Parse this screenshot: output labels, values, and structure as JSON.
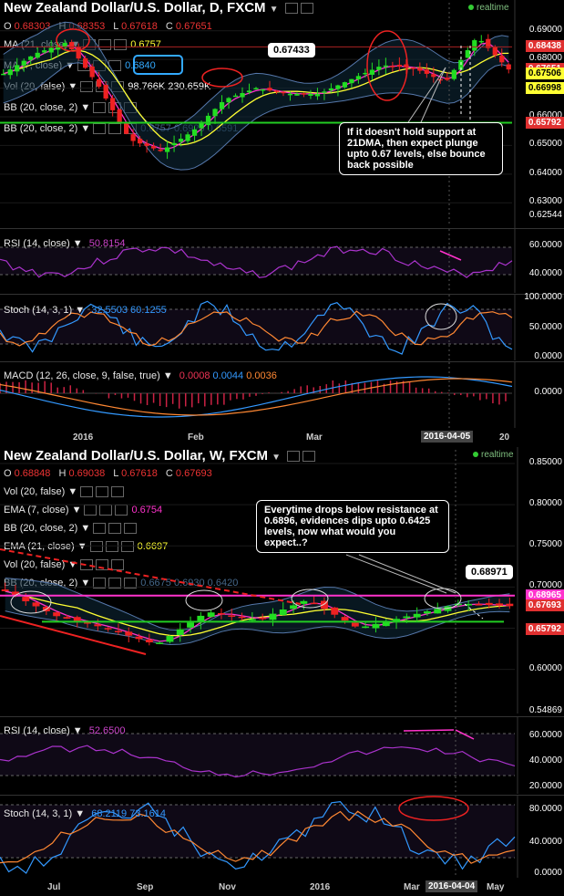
{
  "top": {
    "title": "New Zealand Dollar/U.S. Dollar, D, FXCM",
    "realtime_label": "realtime",
    "ohlc": {
      "o_label": "O",
      "o": "0.68303",
      "h_label": "H",
      "h": "0.68353",
      "l_label": "L",
      "l": "0.67618",
      "c_label": "C",
      "c": "0.67651"
    },
    "indicators": [
      {
        "label": "MA (21, close)",
        "value": "0.6757",
        "color": "#ffff33"
      },
      {
        "label": "MA (7, close)",
        "value": "0.6840",
        "color": "#33aaff"
      },
      {
        "label": "Vol (20, false)",
        "value": "98.766K 230.659K",
        "color": "#ffffff"
      },
      {
        "label": "BB (20, close, 2)",
        "value": "",
        "color": "#ffffff"
      },
      {
        "label": "BB (20, close, 2)",
        "value": "0.6757 0.6923 0.6591",
        "color": "#446688"
      }
    ],
    "price_axis": [
      "0.69000",
      "0.68000",
      "0.67000",
      "0.66000",
      "0.65000",
      "0.64000",
      "0.63000",
      "0.62544"
    ],
    "price_tags": [
      {
        "value": "0.68438",
        "bg": "#e03030",
        "fg": "#ffffff"
      },
      {
        "value": "0.67651",
        "bg": "#e03030",
        "fg": "#ffffff"
      },
      {
        "value": "0.67506",
        "bg": "#ffff33",
        "fg": "#000000"
      },
      {
        "value": "0.66998",
        "bg": "#ffff33",
        "fg": "#000000"
      },
      {
        "value": "0.65792",
        "bg": "#e03030",
        "fg": "#ffffff"
      }
    ],
    "price_label_box": "0.67433",
    "callout": "If it doesn't hold support at 21DMA, then expect plunge upto 0.67 levels, else bounce back possible",
    "rsi": {
      "label": "RSI (14, close)",
      "value": "50.8154",
      "axis": [
        "60.0000",
        "40.0000"
      ]
    },
    "stoch": {
      "label": "Stoch (14, 3, 1)",
      "value": "32.5503 60.1255",
      "axis": [
        "100.0000",
        "50.0000",
        "0.0000"
      ]
    },
    "macd": {
      "label": "MACD (12, 26, close, 9, false, true)",
      "value1": "0.0008",
      "value2": "0.0044",
      "value3": "0.0036",
      "axis": [
        "0.0000"
      ]
    },
    "x_axis": {
      "labels": [
        "2016",
        "Feb",
        "Mar",
        "20"
      ],
      "selected": "2016-04-05"
    }
  },
  "bottom": {
    "title": "New Zealand Dollar/U.S. Dollar, W, FXCM",
    "realtime_label": "realtime",
    "ohlc": {
      "o_label": "O",
      "o": "0.68848",
      "h_label": "H",
      "h": "0.69038",
      "l_label": "L",
      "l": "0.67618",
      "c_label": "C",
      "c": "0.67693"
    },
    "indicators": [
      {
        "label": "Vol (20, false)",
        "value": "",
        "color": "#ffffff"
      },
      {
        "label": "EMA (7, close)",
        "value": "0.6754",
        "color": "#ff33cc"
      },
      {
        "label": "BB (20, close, 2)",
        "value": "",
        "color": "#ffffff"
      },
      {
        "label": "EMA (21, close)",
        "value": "0.6697",
        "color": "#ffff33"
      },
      {
        "label": "Vol (20, false)",
        "value": "",
        "color": "#ffffff"
      },
      {
        "label": "BB (20, close, 2)",
        "value": "0.6675 0.6930 0.6420",
        "color": "#446688"
      }
    ],
    "price_axis": [
      "0.85000",
      "0.80000",
      "0.75000",
      "0.70000",
      "0.65000",
      "0.60000",
      "0.54869"
    ],
    "price_tags": [
      {
        "value": "0.68965",
        "bg": "#ff33cc",
        "fg": "#ffffff"
      },
      {
        "value": "0.67693",
        "bg": "#e03030",
        "fg": "#ffffff"
      },
      {
        "value": "0.65792",
        "bg": "#e03030",
        "fg": "#ffffff"
      }
    ],
    "price_label_box": "0.68971",
    "callout": "Everytime drops below resistance at 0.6896, evidences dips upto 0.6425 levels, now what would you expect..?",
    "rsi": {
      "label": "RSI (14, close)",
      "value": "52.6500",
      "axis": [
        "60.0000",
        "40.0000",
        "20.0000"
      ]
    },
    "stoch": {
      "label": "Stoch (14, 3, 1)",
      "value": "68.2119 73.1614",
      "axis": [
        "80.0000",
        "40.0000",
        "0.0000"
      ]
    },
    "x_axis": {
      "labels": [
        "Jul",
        "Sep",
        "Nov",
        "2016",
        "Mar",
        "May"
      ],
      "selected": "2016-04-04"
    }
  },
  "colors": {
    "up": "#22dd22",
    "down": "#ee2222",
    "ma7": "#ff33cc",
    "ma21": "#ffff33",
    "bb": "#5577aa",
    "support": "#22cc22",
    "resistance": "#ff33cc"
  },
  "chart_data": [
    {
      "type": "line",
      "title": "New Zealand Dollar/U.S. Dollar, D, FXCM",
      "ylim": [
        0.625,
        0.695
      ],
      "x": [
        "2015-12-14",
        "2015-12-21",
        "2015-12-28",
        "2016-01-04",
        "2016-01-11",
        "2016-01-18",
        "2016-01-25",
        "2016-02-01",
        "2016-02-08",
        "2016-02-15",
        "2016-02-22",
        "2016-02-29",
        "2016-03-07",
        "2016-03-14",
        "2016-03-21",
        "2016-03-28",
        "2016-04-05"
      ],
      "series": [
        {
          "values": [
            0.675,
            0.682,
            0.686,
            0.671,
            0.652,
            0.648,
            0.655,
            0.666,
            0.67,
            0.668,
            0.668,
            0.673,
            0.678,
            0.677,
            0.672,
            0.688,
            0.6765
          ]
        }
      ],
      "support": 0.65792,
      "resistance": 0.68438
    },
    {
      "type": "line",
      "title": "New Zealand Dollar/U.S. Dollar, W, FXCM",
      "ylim": [
        0.54869,
        0.85
      ],
      "x": [
        "2015-06",
        "2015-07",
        "2015-08",
        "2015-09",
        "2015-10",
        "2015-11",
        "2015-12",
        "2016-01",
        "2016-02",
        "2016-03",
        "2016-04"
      ],
      "series": [
        {
          "values": [
            0.695,
            0.665,
            0.65,
            0.63,
            0.67,
            0.66,
            0.685,
            0.65,
            0.665,
            0.68,
            0.6769
          ]
        }
      ],
      "support": 0.65792,
      "resistance": 0.68965
    }
  ]
}
